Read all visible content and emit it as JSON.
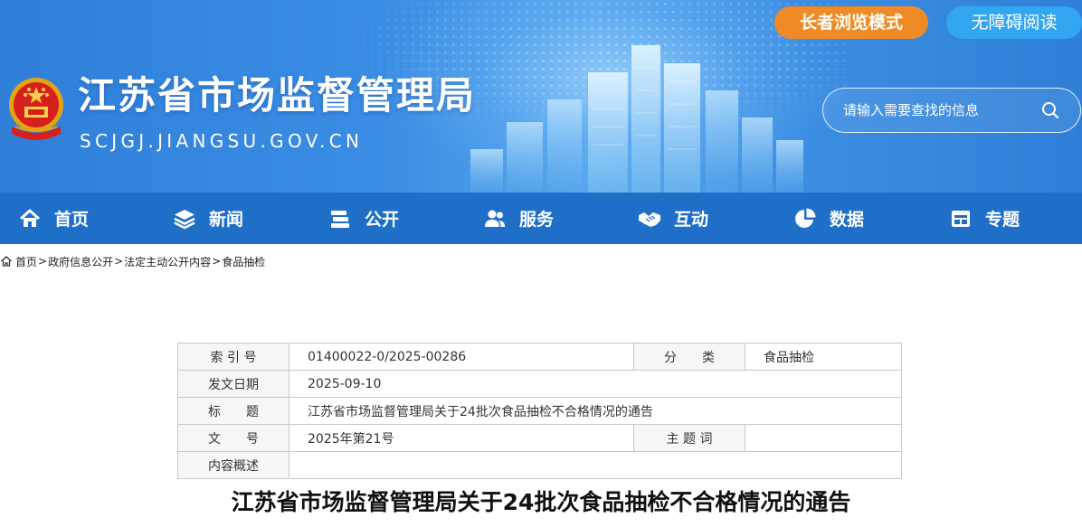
{
  "header": {
    "site_title": "江苏省市场监督管理局",
    "site_domain": "SCJGJ.JIANGSU.GOV.CN",
    "elder_mode_label": "长者浏览模式",
    "accessibility_label": "无障碍阅读",
    "search": {
      "placeholder": "请输入需要查找的信息",
      "value": ""
    },
    "colors": {
      "banner": "#3a8de4",
      "elder_button": "#f08a24",
      "access_button": "#33a6f2"
    }
  },
  "nav": {
    "background": "#1f6fc9",
    "items": [
      {
        "label": "首页",
        "icon": "home-icon"
      },
      {
        "label": "新闻",
        "icon": "layers-icon"
      },
      {
        "label": "公开",
        "icon": "stack-icon"
      },
      {
        "label": "服务",
        "icon": "users-icon"
      },
      {
        "label": "互动",
        "icon": "handshake-icon"
      },
      {
        "label": "数据",
        "icon": "pie-chart-icon"
      },
      {
        "label": "专题",
        "icon": "window-icon"
      }
    ]
  },
  "breadcrumb": {
    "icon": "home-icon",
    "items": [
      "首页",
      "政府信息公开",
      "法定主动公开内容",
      "食品抽检"
    ],
    "separator": ">"
  },
  "info_table": {
    "index_label": "索 引 号",
    "index_value": "01400022-0/2025-00286",
    "category_label": "分　　类",
    "category_value": "食品抽检",
    "date_label": "发文日期",
    "date_value": "2025-09-10",
    "title_label": "标　　题",
    "title_value": "江苏省市场监督管理局关于24批次食品抽检不合格情况的通告",
    "docno_label": "文　　号",
    "docno_value": "2025年第21号",
    "keywords_label": "主 题 词",
    "keywords_value": "",
    "summary_label": "内容概述",
    "summary_value": ""
  },
  "article": {
    "title": "江苏省市场监督管理局关于24批次食品抽检不合格情况的通告"
  }
}
